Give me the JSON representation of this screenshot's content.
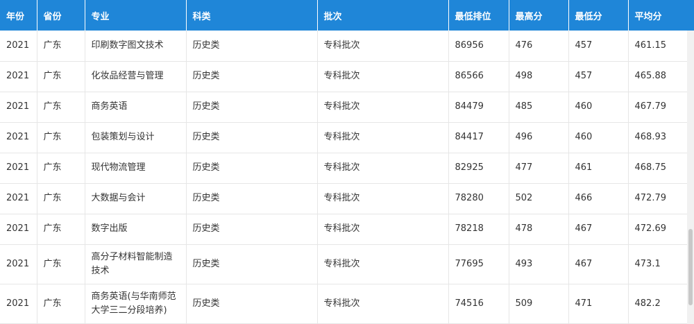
{
  "table": {
    "headers": [
      "年份",
      "省份",
      "专业",
      "科类",
      "批次",
      "最低排位",
      "最高分",
      "最低分",
      "平均分"
    ],
    "rows": [
      [
        "2021",
        "广东",
        "印刷数字图文技术",
        "历史类",
        "专科批次",
        "86956",
        "476",
        "457",
        "461.15"
      ],
      [
        "2021",
        "广东",
        "化妆品经营与管理",
        "历史类",
        "专科批次",
        "86566",
        "498",
        "457",
        "465.88"
      ],
      [
        "2021",
        "广东",
        "商务英语",
        "历史类",
        "专科批次",
        "84479",
        "485",
        "460",
        "467.79"
      ],
      [
        "2021",
        "广东",
        "包装策划与设计",
        "历史类",
        "专科批次",
        "84417",
        "496",
        "460",
        "468.93"
      ],
      [
        "2021",
        "广东",
        "现代物流管理",
        "历史类",
        "专科批次",
        "82925",
        "477",
        "461",
        "468.75"
      ],
      [
        "2021",
        "广东",
        "大数据与会计",
        "历史类",
        "专科批次",
        "78280",
        "502",
        "466",
        "472.79"
      ],
      [
        "2021",
        "广东",
        "数字出版",
        "历史类",
        "专科批次",
        "78218",
        "478",
        "467",
        "472.69"
      ],
      [
        "2021",
        "广东",
        "高分子材料智能制造技术",
        "历史类",
        "专科批次",
        "77695",
        "493",
        "467",
        "473.1"
      ],
      [
        "2021",
        "广东",
        "商务英语(与华南师范大学三二分段培养)",
        "历史类",
        "专科批次",
        "74516",
        "509",
        "471",
        "482.2"
      ]
    ]
  },
  "colors": {
    "header_bg": "#1f86d8",
    "header_text": "#ffffff",
    "border": "#e6e6e6",
    "text": "#333333"
  }
}
